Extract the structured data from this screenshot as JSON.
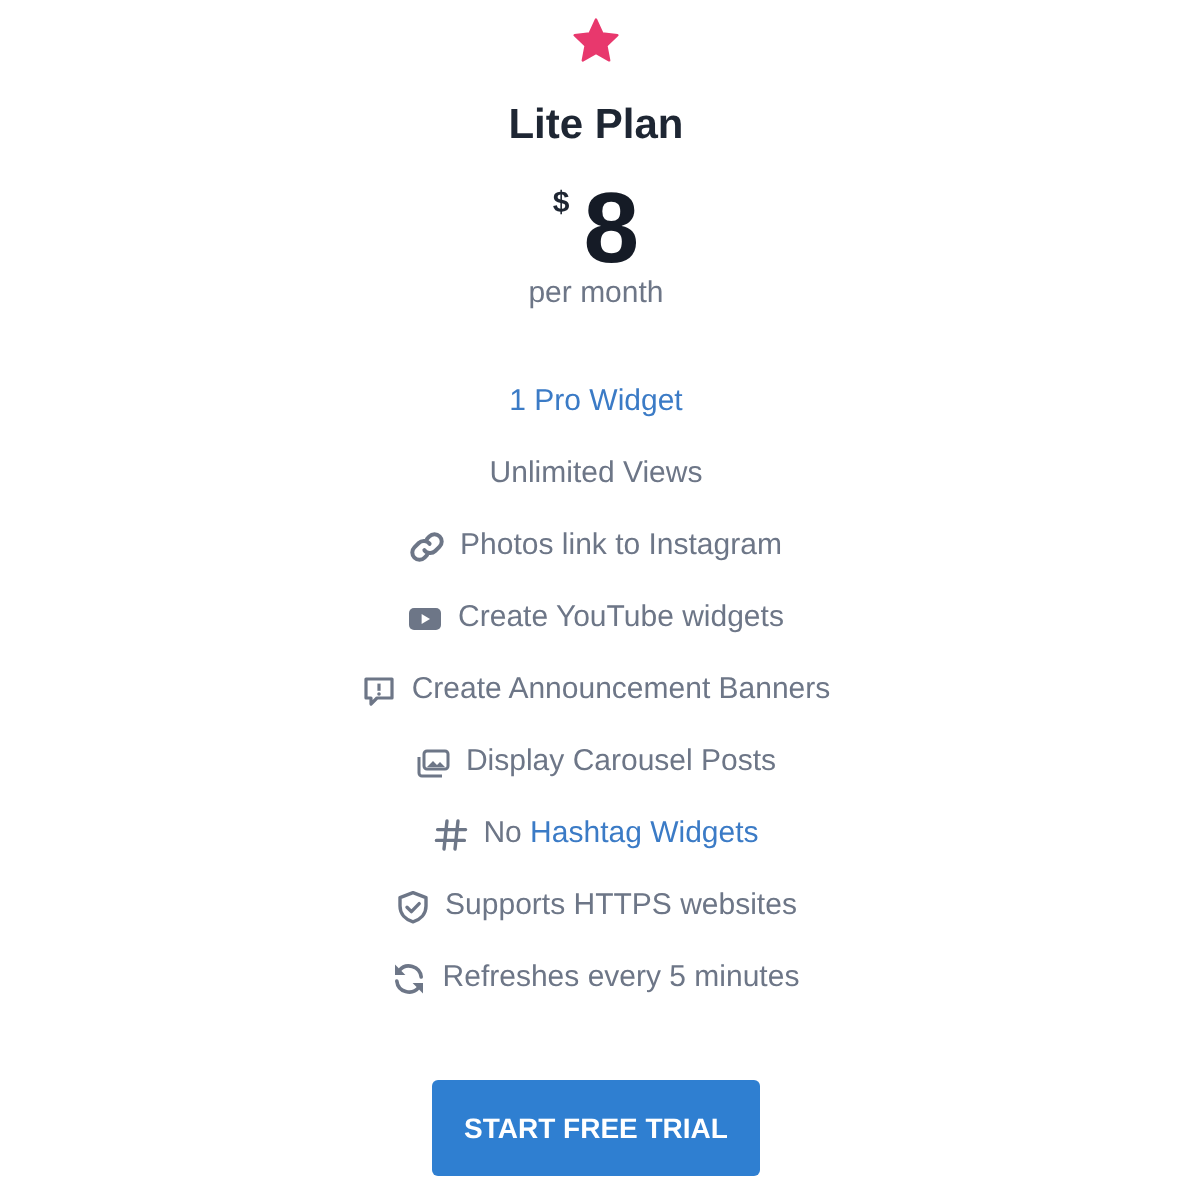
{
  "plan": {
    "title": "Lite Plan",
    "currency": "$",
    "price": "8",
    "period": "per month"
  },
  "features": [
    {
      "kind": "plain",
      "link": "1 Pro Widget"
    },
    {
      "kind": "plain",
      "text": "Unlimited Views"
    },
    {
      "kind": "link",
      "text": "Photos link to Instagram"
    },
    {
      "kind": "video",
      "text": "Create YouTube widgets"
    },
    {
      "kind": "message",
      "text": "Create Announcement Banners"
    },
    {
      "kind": "images",
      "text": "Display Carousel Posts"
    },
    {
      "kind": "hash",
      "text": "No",
      "link": "Hashtag Widgets"
    },
    {
      "kind": "shield",
      "text": "Supports HTTPS websites"
    },
    {
      "kind": "refresh",
      "text": "Refreshes every 5 minutes"
    }
  ],
  "button": {
    "label": "START FREE TRIAL"
  }
}
